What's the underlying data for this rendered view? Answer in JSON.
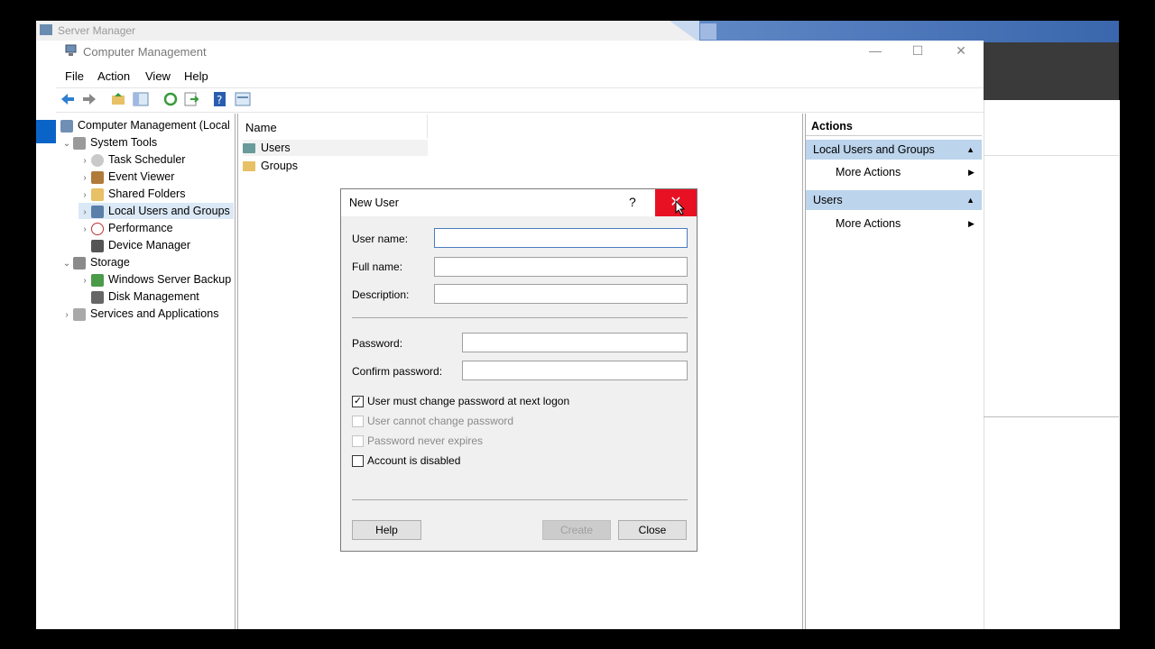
{
  "server_manager": {
    "title": "Server Manager"
  },
  "window": {
    "title": "Computer Management",
    "min": "—",
    "max": "☐",
    "close": "✕"
  },
  "menu": [
    "File",
    "Action",
    "View",
    "Help"
  ],
  "tree": {
    "root": "Computer Management (Local",
    "items": [
      {
        "label": "System Tools",
        "indent": 1,
        "chevron": "⌄"
      },
      {
        "label": "Task Scheduler",
        "indent": 2,
        "chevron": "›"
      },
      {
        "label": "Event Viewer",
        "indent": 2,
        "chevron": "›"
      },
      {
        "label": "Shared Folders",
        "indent": 2,
        "chevron": "›"
      },
      {
        "label": "Local Users and Groups",
        "indent": 2,
        "chevron": "›"
      },
      {
        "label": "Performance",
        "indent": 2,
        "chevron": "›"
      },
      {
        "label": "Device Manager",
        "indent": 2,
        "chevron": ""
      },
      {
        "label": "Storage",
        "indent": 1,
        "chevron": "⌄"
      },
      {
        "label": "Windows Server Backup",
        "indent": 2,
        "chevron": "›"
      },
      {
        "label": "Disk Management",
        "indent": 2,
        "chevron": ""
      },
      {
        "label": "Services and Applications",
        "indent": 1,
        "chevron": "›"
      }
    ]
  },
  "list": {
    "column": "Name",
    "rows": [
      "Users",
      "Groups"
    ]
  },
  "actions": {
    "header": "Actions",
    "sections": [
      {
        "title": "Local Users and Groups",
        "item": "More Actions"
      },
      {
        "title": "Users",
        "item": "More Actions"
      }
    ]
  },
  "dialog": {
    "title": "New User",
    "help": "?",
    "close_glyph": "✕",
    "fields": {
      "user_name": {
        "label": "User name:",
        "value": ""
      },
      "full_name": {
        "label": "Full name:",
        "value": ""
      },
      "description": {
        "label": "Description:",
        "value": ""
      },
      "password": {
        "label": "Password:",
        "value": ""
      },
      "confirm_password": {
        "label": "Confirm password:",
        "value": ""
      }
    },
    "checkboxes": [
      {
        "label": "User must change password at next logon",
        "checked": true,
        "enabled": true
      },
      {
        "label": "User cannot change password",
        "checked": false,
        "enabled": false
      },
      {
        "label": "Password never expires",
        "checked": false,
        "enabled": false
      },
      {
        "label": "Account is disabled",
        "checked": false,
        "enabled": true
      }
    ],
    "buttons": {
      "help": "Help",
      "create": "Create",
      "close": "Close"
    }
  },
  "colors": {
    "close_red": "#e81123",
    "action_section": "#bcd4ec",
    "selection": "#dbe9f7"
  }
}
